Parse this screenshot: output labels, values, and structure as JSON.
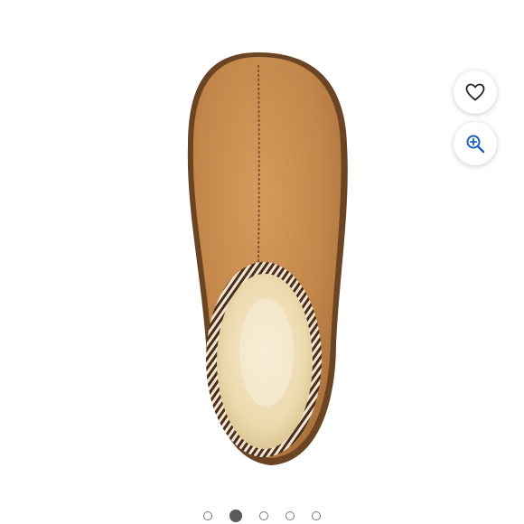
{
  "gallery": {
    "active_index": 1,
    "slides": [
      {
        "index": 0
      },
      {
        "index": 1
      },
      {
        "index": 2
      },
      {
        "index": 3
      },
      {
        "index": 4
      }
    ]
  },
  "actions": {
    "favorite_icon": "heart-icon",
    "zoom_icon": "zoom-in-icon"
  },
  "colors": {
    "suede": "#c78a4e",
    "suede_dark": "#8a5428",
    "sole": "#6b4424",
    "fleece": "#f0dfb8",
    "zoom_accent": "#1a5fbf",
    "dot_active": "#5a5a5a"
  }
}
